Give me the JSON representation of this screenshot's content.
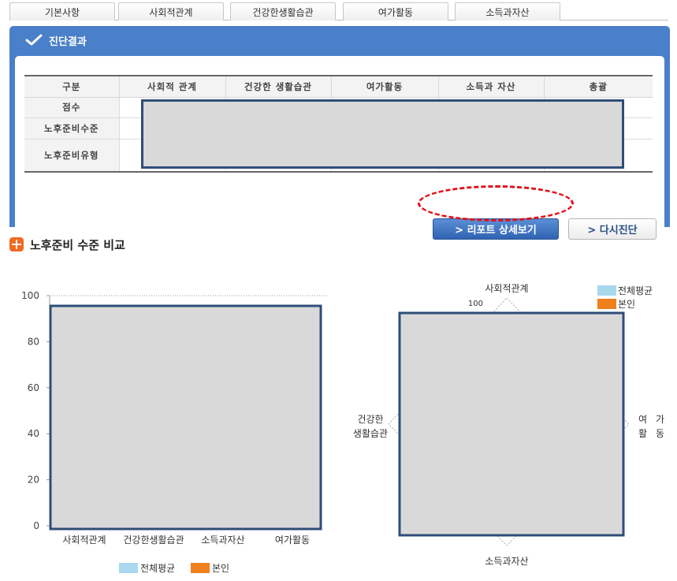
{
  "tabs": [
    "기본사항",
    "사회적관계",
    "건강한생활습관",
    "여가활동",
    "소득과자산"
  ],
  "panel": {
    "title": "진단결과"
  },
  "table": {
    "headers": [
      "구분",
      "사회적 관계",
      "건강한 생활습관",
      "여가활동",
      "소득과 자산",
      "총괄"
    ],
    "rows": [
      "점수",
      "노후준비수준",
      "노후준비유형"
    ]
  },
  "buttons": {
    "report": "> 리포트 상세보기",
    "retry": "> 다시진단"
  },
  "section": {
    "title": "노후준비 수준 비교"
  },
  "colors": {
    "average": "#a8d8ee",
    "self": "#f0801c",
    "panel_blue": "#4a7fc9"
  },
  "chart_data": [
    {
      "type": "bar",
      "categories": [
        "사회적관계",
        "건강한생활습관",
        "소득과자산",
        "여가활동"
      ],
      "y_ticks": [
        "0",
        "20",
        "40",
        "60",
        "80",
        "100"
      ],
      "ylim": [
        0,
        100
      ],
      "legend": [
        "전체평균",
        "본인"
      ],
      "legend_position": "bottom"
    },
    {
      "type": "radar",
      "axes": [
        "사회적관계",
        "여가활동",
        "소득과자산",
        "건강한생활습관"
      ],
      "axis_labels": {
        "top": "사회적관계",
        "right_a": "여",
        "right_b": "가",
        "right_c": "활",
        "right_d": "동",
        "bottom": "소득과자산",
        "left_a": "건강한",
        "left_b": "생활습관"
      },
      "max_label": "100",
      "legend": [
        "전체평균",
        "본인"
      ],
      "legend_position": "top-right"
    }
  ]
}
